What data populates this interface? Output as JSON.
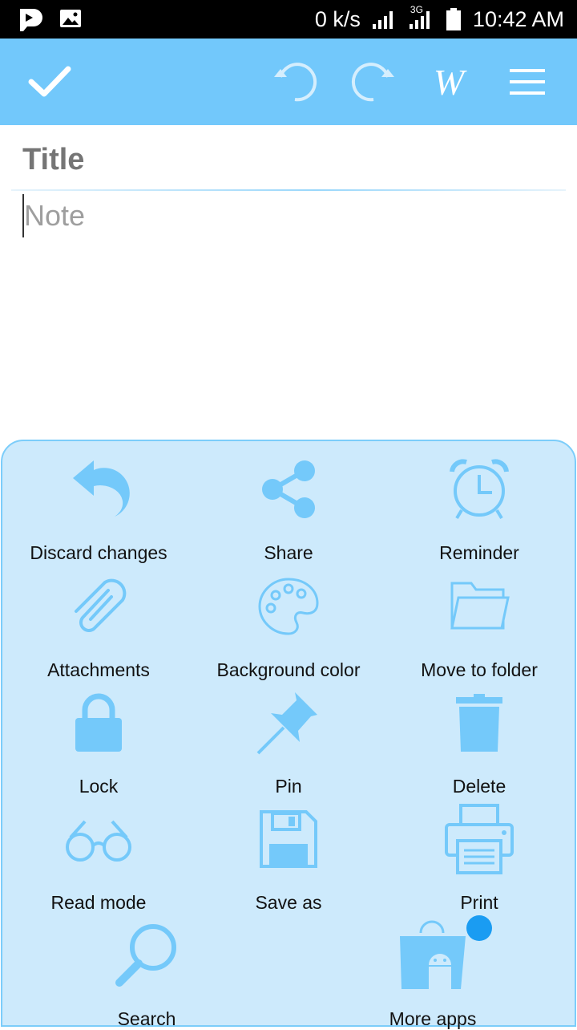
{
  "status_bar": {
    "speed": "0 k/s",
    "network": "3G",
    "time": "10:42 AM"
  },
  "toolbar": {
    "save_icon": "check-icon",
    "undo_icon": "undo-icon",
    "redo_icon": "redo-icon",
    "wiki_label": "W",
    "menu_icon": "hamburger-icon"
  },
  "editor": {
    "title_placeholder": "Title",
    "note_placeholder": "Note"
  },
  "menu": {
    "items": [
      {
        "label": "Discard changes",
        "icon": "discard-icon"
      },
      {
        "label": "Share",
        "icon": "share-icon"
      },
      {
        "label": "Reminder",
        "icon": "alarm-clock-icon"
      },
      {
        "label": "Attachments",
        "icon": "paperclip-icon"
      },
      {
        "label": "Background color",
        "icon": "palette-icon"
      },
      {
        "label": "Move to folder",
        "icon": "folder-icon"
      },
      {
        "label": "Lock",
        "icon": "lock-icon"
      },
      {
        "label": "Pin",
        "icon": "pin-icon"
      },
      {
        "label": "Delete",
        "icon": "trash-icon"
      },
      {
        "label": "Read mode",
        "icon": "glasses-icon"
      },
      {
        "label": "Save as",
        "icon": "floppy-icon"
      },
      {
        "label": "Print",
        "icon": "printer-icon"
      },
      {
        "label": "Search",
        "icon": "search-icon"
      },
      {
        "label": "More apps",
        "icon": "android-bag-icon"
      }
    ]
  },
  "colors": {
    "toolbar": "#72c8fb",
    "sheet": "#cdeafc",
    "icon": "#74c9fa",
    "badge": "#1a9cf2"
  }
}
